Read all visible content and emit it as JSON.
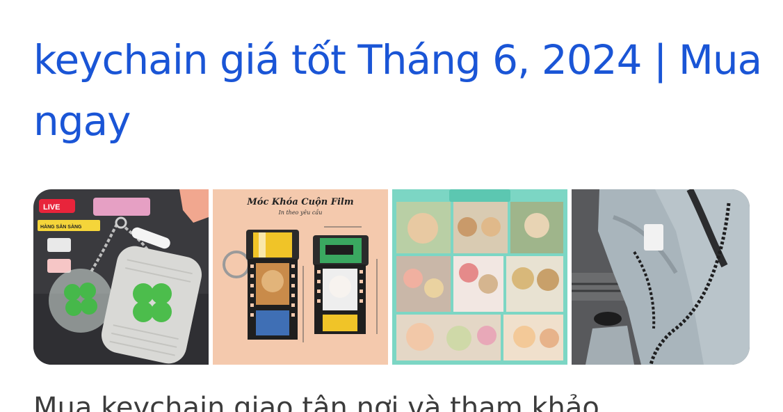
{
  "result": {
    "title": "keychain giá tốt Tháng 6, 2024 | Mua ngay",
    "snippet": "Mua keychain giao tận nơi và tham khảo"
  },
  "thumbnails": [
    {
      "name": "clover-keychain-photo",
      "badges": [
        "LIVE",
        "HÀNG SẴN SÀNG"
      ]
    },
    {
      "name": "film-roll-keychain-photo",
      "heading": "Móc Khóa Cuộn Film",
      "subheading": "In theo yêu cầu"
    },
    {
      "name": "pet-keychain-collage-photo"
    },
    {
      "name": "jeans-chain-keychain-photo"
    }
  ],
  "colors": {
    "title": "#1a55d6",
    "snippet": "#3c3c3c",
    "background": "#ffffff"
  }
}
